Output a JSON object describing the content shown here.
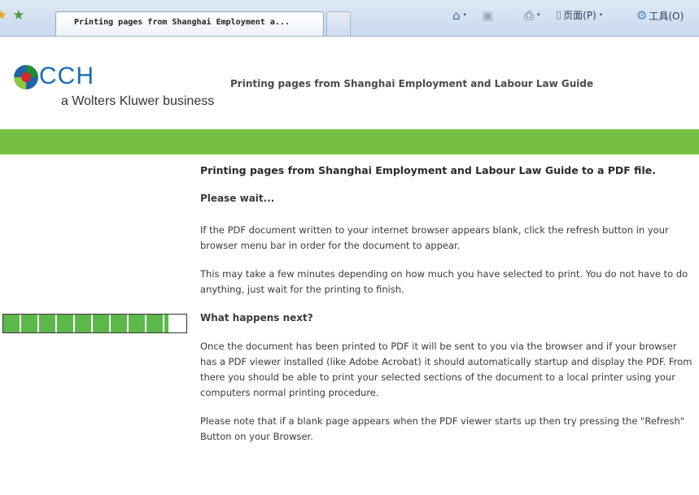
{
  "browser": {
    "tab_title": "Printing pages from Shanghai Employment a...",
    "home_icon": "home-icon",
    "feeds_icon": "feeds-icon",
    "print_icon": "print-icon",
    "page_menu_label": "页面(P)",
    "tools_menu_label": "工具(O)"
  },
  "header": {
    "logo_text": "CCH",
    "logo_tagline": "a Wolters Kluwer business",
    "title": "Printing pages from Shanghai Employment and Labour Law Guide"
  },
  "progress": {
    "percent": 90
  },
  "content": {
    "heading": "Printing pages from Shanghai Employment and Labour Law Guide to a PDF file.",
    "please_wait": "Please wait...",
    "refresh_note": "If the PDF document written to your internet browser appears blank, click the refresh button in your browser menu bar in order for the document to appear.",
    "time_note": "This may take a few minutes depending on how much you have selected to print. You do not have to do anything, just wait for the printing to finish.",
    "next_heading": "What happens next?",
    "next_text": "Once the document has been printed to PDF it will be sent to you via the browser and if your browser has a PDF viewer installed (like Adobe Acrobat) it should automatically startup and display the PDF. From there you should be able to print your selected sections of the document to a local printer using your computers normal printing procedure.",
    "blank_note": "Please note that if a blank page appears when the PDF viewer starts up then try pressing the \"Refresh\" Button on your Browser."
  },
  "colors": {
    "green_band": "#77bf43",
    "progress_fill": "#5cb84a",
    "logo_blue": "#1b6bb4"
  }
}
